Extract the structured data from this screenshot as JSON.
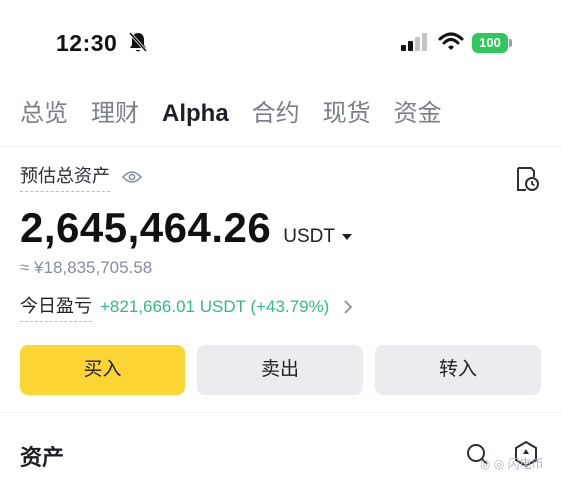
{
  "status_bar": {
    "time": "12:30",
    "battery": "100",
    "icons": [
      "bell-muted-icon",
      "signal-icon",
      "wifi-icon",
      "battery-icon"
    ],
    "battery_color": "#30c85a"
  },
  "tabs": [
    {
      "label": "总览",
      "active": false
    },
    {
      "label": "理财",
      "active": false
    },
    {
      "label": "Alpha",
      "active": true
    },
    {
      "label": "合约",
      "active": false
    },
    {
      "label": "现货",
      "active": false
    },
    {
      "label": "资金",
      "active": false
    }
  ],
  "summary": {
    "label": "预估总资产",
    "balance": "2,645,464.26",
    "currency": "USDT",
    "approx": "≈ ¥18,835,705.58",
    "pnl_label": "今日盈亏",
    "pnl_value": "+821,666.01 USDT (+43.79%)",
    "pnl_color": "#2ebd85"
  },
  "actions": {
    "buy": "买入",
    "sell": "卖出",
    "transfer": "转入",
    "accent": "#fcd535"
  },
  "assets": {
    "title": "资产"
  },
  "watermark": "◎ ◎ 闪电币"
}
